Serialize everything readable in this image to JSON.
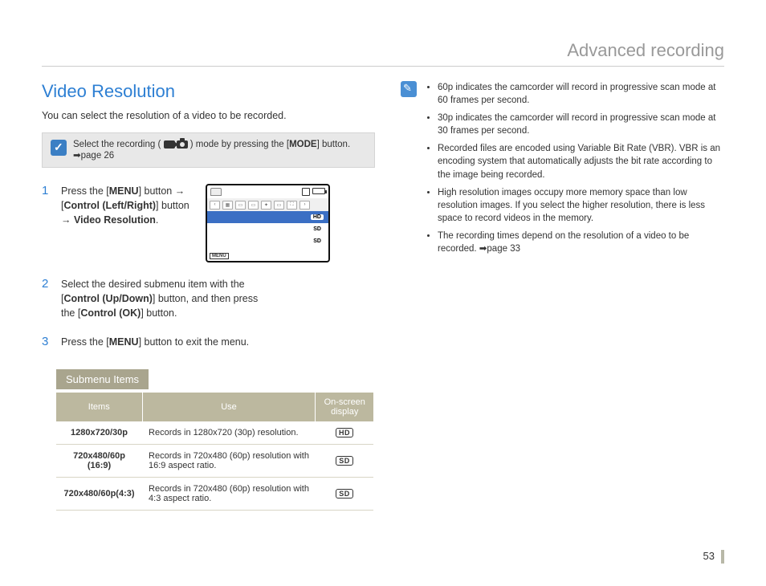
{
  "header": {
    "title": "Advanced recording"
  },
  "main": {
    "title": "Video Resolution",
    "intro": "You can select the resolution of a video to be recorded.",
    "mode_note_pre": "Select the recording (",
    "mode_note_post": ") mode by pressing the [",
    "mode_label": "MODE",
    "mode_note_tail": "] button. ",
    "mode_note_ref": "➡page 26",
    "steps": [
      {
        "num": "1",
        "parts": [
          "Press the [",
          "MENU",
          "] button → [",
          "Control (Left/Right)",
          "] button → ",
          "Video Resolution",
          "."
        ]
      },
      {
        "num": "2",
        "parts": [
          "Select the desired submenu item with the [",
          "Control (Up/Down)",
          "] button, and then press the [",
          "Control (OK)",
          "] button."
        ]
      },
      {
        "num": "3",
        "parts": [
          "Press the [",
          "MENU",
          "] button to exit the menu."
        ]
      }
    ],
    "lcd": {
      "menu_label": "MENU",
      "items": [
        {
          "badge": "HD",
          "selected": true
        },
        {
          "badge": "SD",
          "selected": false
        },
        {
          "badge": "SD",
          "selected": false
        }
      ]
    },
    "submenu_title": "Submenu Items",
    "table": {
      "headers": [
        "Items",
        "Use",
        "On-screen display"
      ],
      "rows": [
        {
          "item": "1280x720/30p",
          "use": "Records in 1280x720 (30p) resolution.",
          "osd": "HD"
        },
        {
          "item": "720x480/60p (16:9)",
          "use": "Records in 720x480 (60p) resolution with 16:9 aspect ratio.",
          "osd": "SD"
        },
        {
          "item": "720x480/60p(4:3)",
          "use": "Records in 720x480 (60p) resolution with 4:3 aspect ratio.",
          "osd": "SD"
        }
      ]
    }
  },
  "side_notes": [
    "60p indicates the camcorder will record in progressive scan mode at 60 frames per second.",
    "30p indicates the camcorder will record in progressive scan mode at 30 frames per second.",
    "Recorded files are encoded using Variable Bit Rate (VBR). VBR is an encoding system that automatically adjusts the bit rate according to the image being recorded.",
    "High resolution images occupy more memory space than low resolution images. If you select the higher resolution, there is less space to record videos in the memory.",
    "The recording times depend on the resolution of a video to be recorded. ➡page 33"
  ],
  "page_number": "53"
}
